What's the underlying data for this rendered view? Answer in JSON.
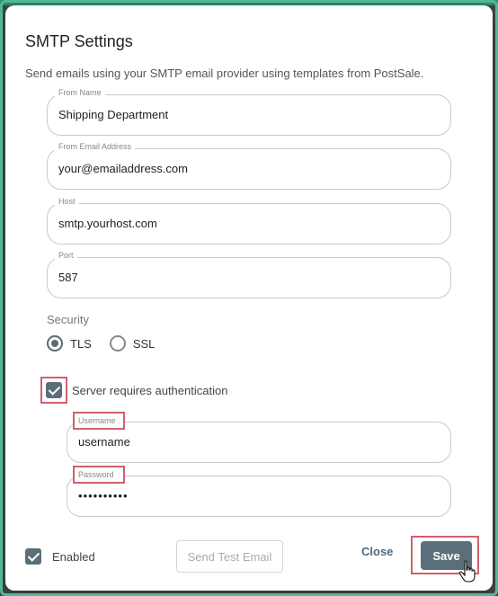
{
  "dialog": {
    "title": "SMTP Settings",
    "subtitle": "Send emails using your SMTP email provider using templates from PostSale."
  },
  "fields": {
    "from_name": {
      "label": "From Name",
      "value": "Shipping Department"
    },
    "from_email": {
      "label": "From Email Address",
      "value": "your@emailaddress.com"
    },
    "host": {
      "label": "Host",
      "value": "smtp.yourhost.com"
    },
    "port": {
      "label": "Port",
      "value": "587"
    }
  },
  "security": {
    "label": "Security",
    "options": [
      {
        "label": "TLS",
        "selected": true
      },
      {
        "label": "SSL",
        "selected": false
      }
    ]
  },
  "auth": {
    "label": "Server requires authentication",
    "checked": true,
    "username": {
      "label": "Username",
      "value": "username"
    },
    "password": {
      "label": "Password",
      "value": "••••••••••"
    }
  },
  "footer": {
    "enabled_label": "Enabled",
    "enabled_checked": true,
    "send_test_label": "Send Test Email",
    "close_label": "Close",
    "save_label": "Save"
  },
  "colors": {
    "accent": "#5a6f7a",
    "highlight": "#d0606e",
    "backdrop": "#3f4a47"
  }
}
